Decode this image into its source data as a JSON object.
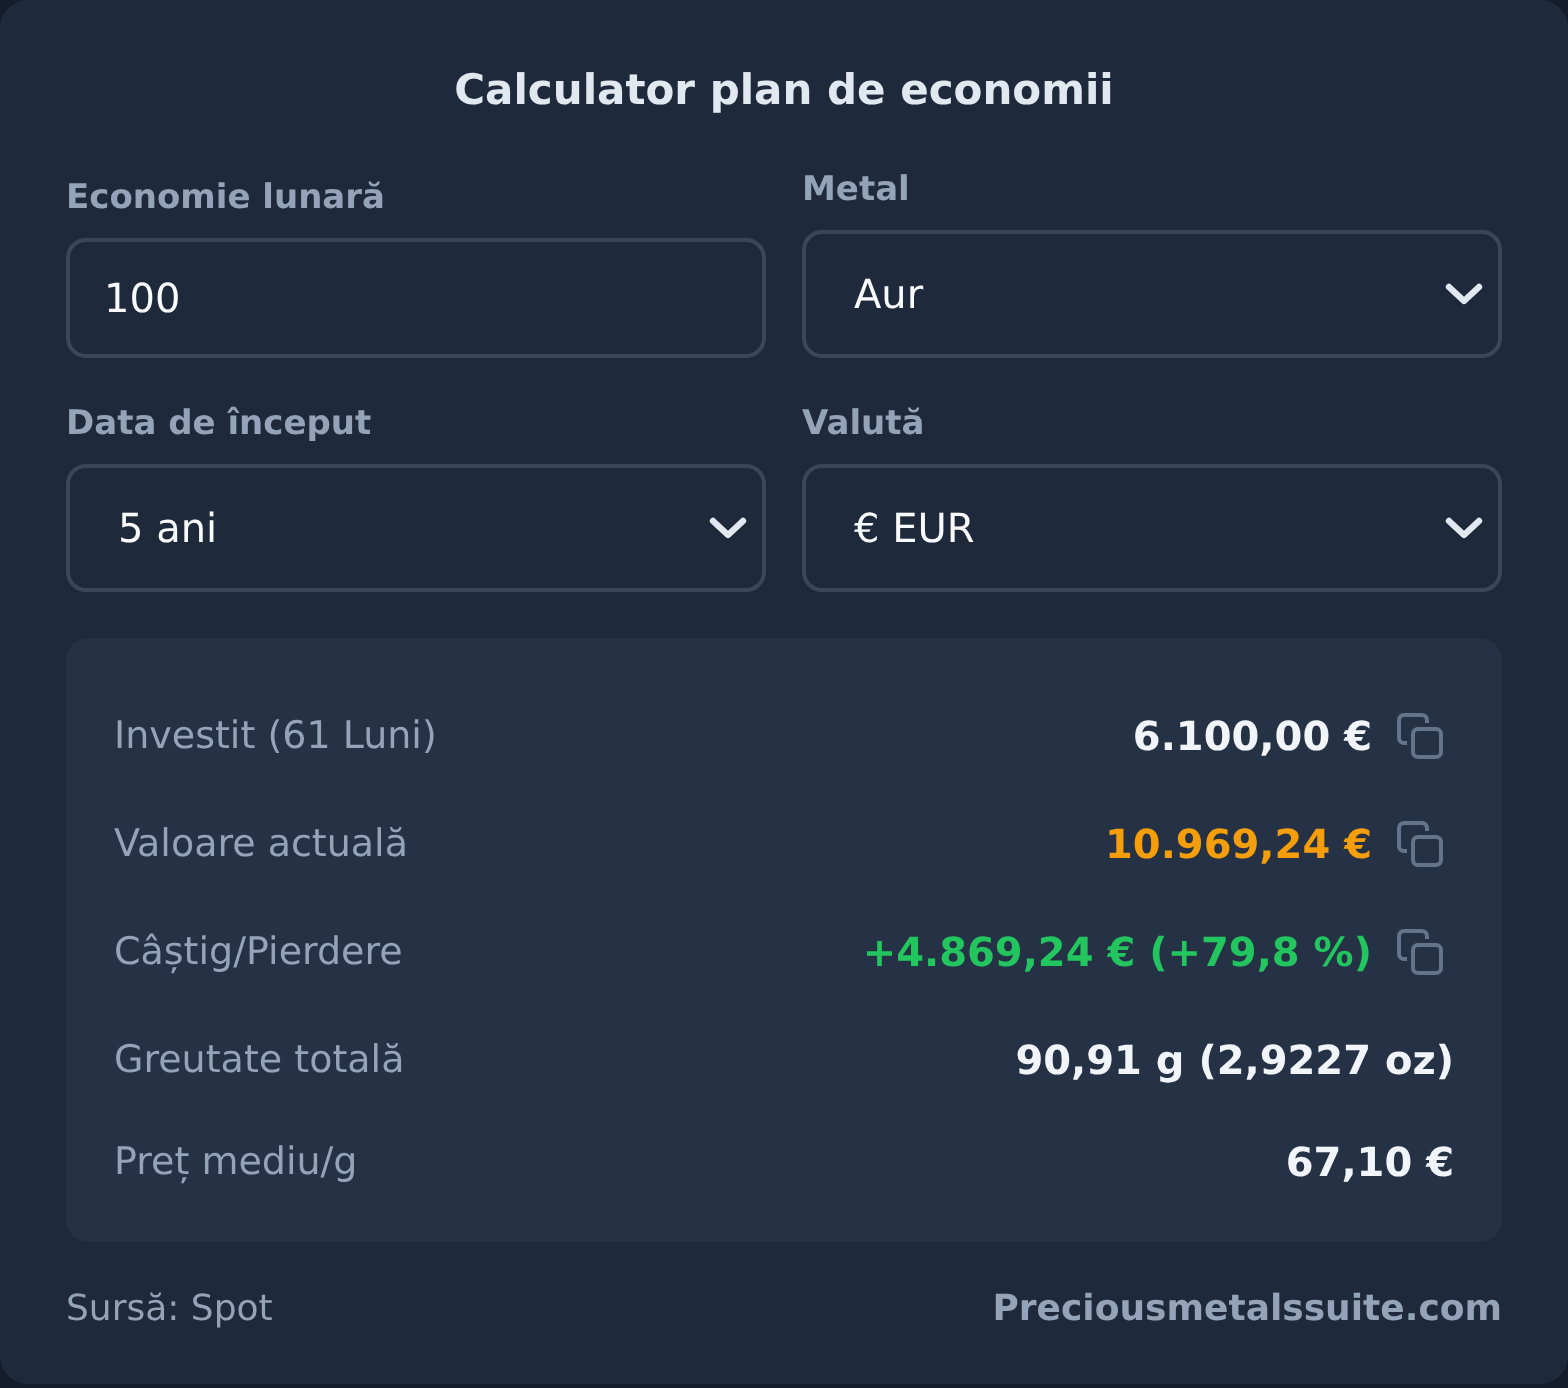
{
  "title": "Calculator plan de economii",
  "fields": [
    {
      "kind": "input",
      "label": "Economie lunară",
      "value": "100"
    },
    {
      "kind": "select",
      "label": "Metal",
      "value": "Aur"
    },
    {
      "kind": "select",
      "label": "Data de început",
      "value": "5 ani"
    },
    {
      "kind": "select",
      "label": "Valută",
      "value": "€ EUR"
    }
  ],
  "results": [
    {
      "label": "Investit (61 Luni)",
      "value": "6.100,00 €",
      "color": "#f1f5f9",
      "copyable": true
    },
    {
      "label": "Valoare actuală",
      "value": "10.969,24 €",
      "color": "#f59e0b",
      "copyable": true
    },
    {
      "label": "Câștig/Pierdere",
      "value": "+4.869,24 € (+79,8 %)",
      "color": "#22c55e",
      "copyable": true
    },
    {
      "label": "Greutate totală",
      "value": "90,91 g (2,9227 oz)",
      "color": "#f1f5f9",
      "copyable": false
    },
    {
      "label": "Preț mediu/g",
      "value": "67,10 €",
      "color": "#f1f5f9",
      "copyable": false
    }
  ],
  "footer": {
    "source": "Sursă: Spot",
    "link": "Preciousmetalssuite.com"
  }
}
